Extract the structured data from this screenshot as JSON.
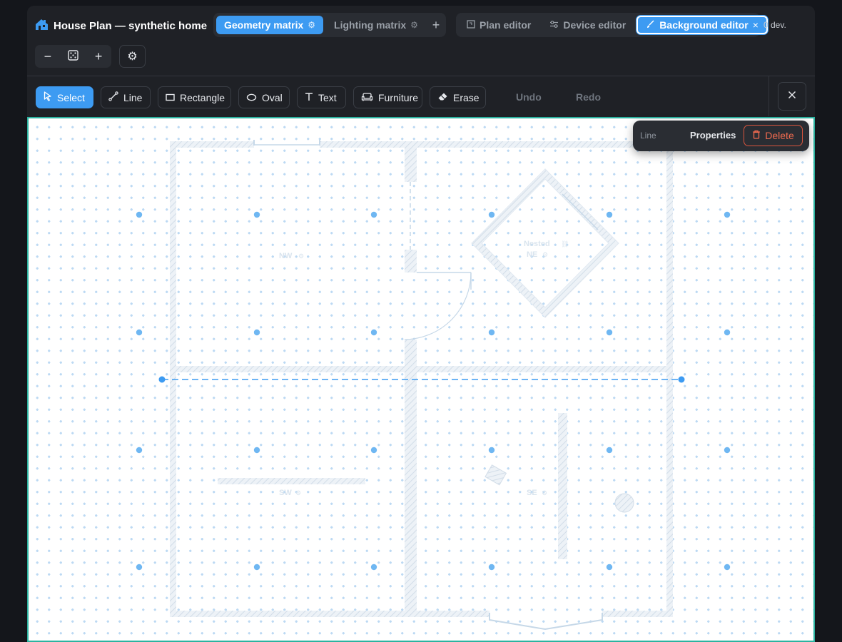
{
  "app": {
    "title": "House Plan — synthetic home",
    "icon": "house-icon"
  },
  "matrix_tabs": [
    {
      "label": "Geometry matrix",
      "icon": "gear-icon",
      "active": true
    },
    {
      "label": "Lighting matrix",
      "icon": "gear-icon",
      "active": false
    }
  ],
  "add_tab_label": "+",
  "editor_tabs": [
    {
      "label": "Plan editor",
      "icon": "plan-icon"
    },
    {
      "label": "Device editor",
      "icon": "sliders-icon"
    },
    {
      "label": "Background editor",
      "icon": "brush-icon",
      "active": true,
      "close": "×"
    }
  ],
  "device_count": "0 dev.",
  "zoom": {
    "minus": "−",
    "plus": "+",
    "fit_icon": "dice-icon"
  },
  "settings_icon": "gear-icon",
  "tools": [
    {
      "label": "Select",
      "icon": "cursor-icon",
      "active": true
    },
    {
      "label": "Line",
      "icon": "line-icon"
    },
    {
      "label": "Rectangle",
      "icon": "rectangle-icon"
    },
    {
      "label": "Oval",
      "icon": "oval-icon"
    },
    {
      "label": "Text",
      "icon": "text-icon"
    },
    {
      "label": "Furniture",
      "icon": "sofa-icon"
    },
    {
      "label": "Erase",
      "icon": "eraser-icon"
    }
  ],
  "history": {
    "undo": "Undo",
    "redo": "Redo"
  },
  "close_icon": "close-icon",
  "selection_panel": {
    "kind": "Line",
    "properties": "Properties",
    "delete": "Delete",
    "delete_icon": "trash-icon"
  },
  "rooms": [
    {
      "name": "NW",
      "icon": "settings-icon"
    },
    {
      "name": "Nested",
      "icon": "link-icon"
    },
    {
      "name": "NE",
      "icon": "settings-icon"
    },
    {
      "name": "SW",
      "icon": "settings-icon"
    },
    {
      "name": "SE",
      "icon": "settings-icon"
    }
  ],
  "colors": {
    "accent": "#3d9bf2",
    "canvas_border": "#2bb3a0",
    "danger": "#d9553d",
    "wall": "#dbe6f0",
    "grid_dot": "#bcd9f3"
  }
}
